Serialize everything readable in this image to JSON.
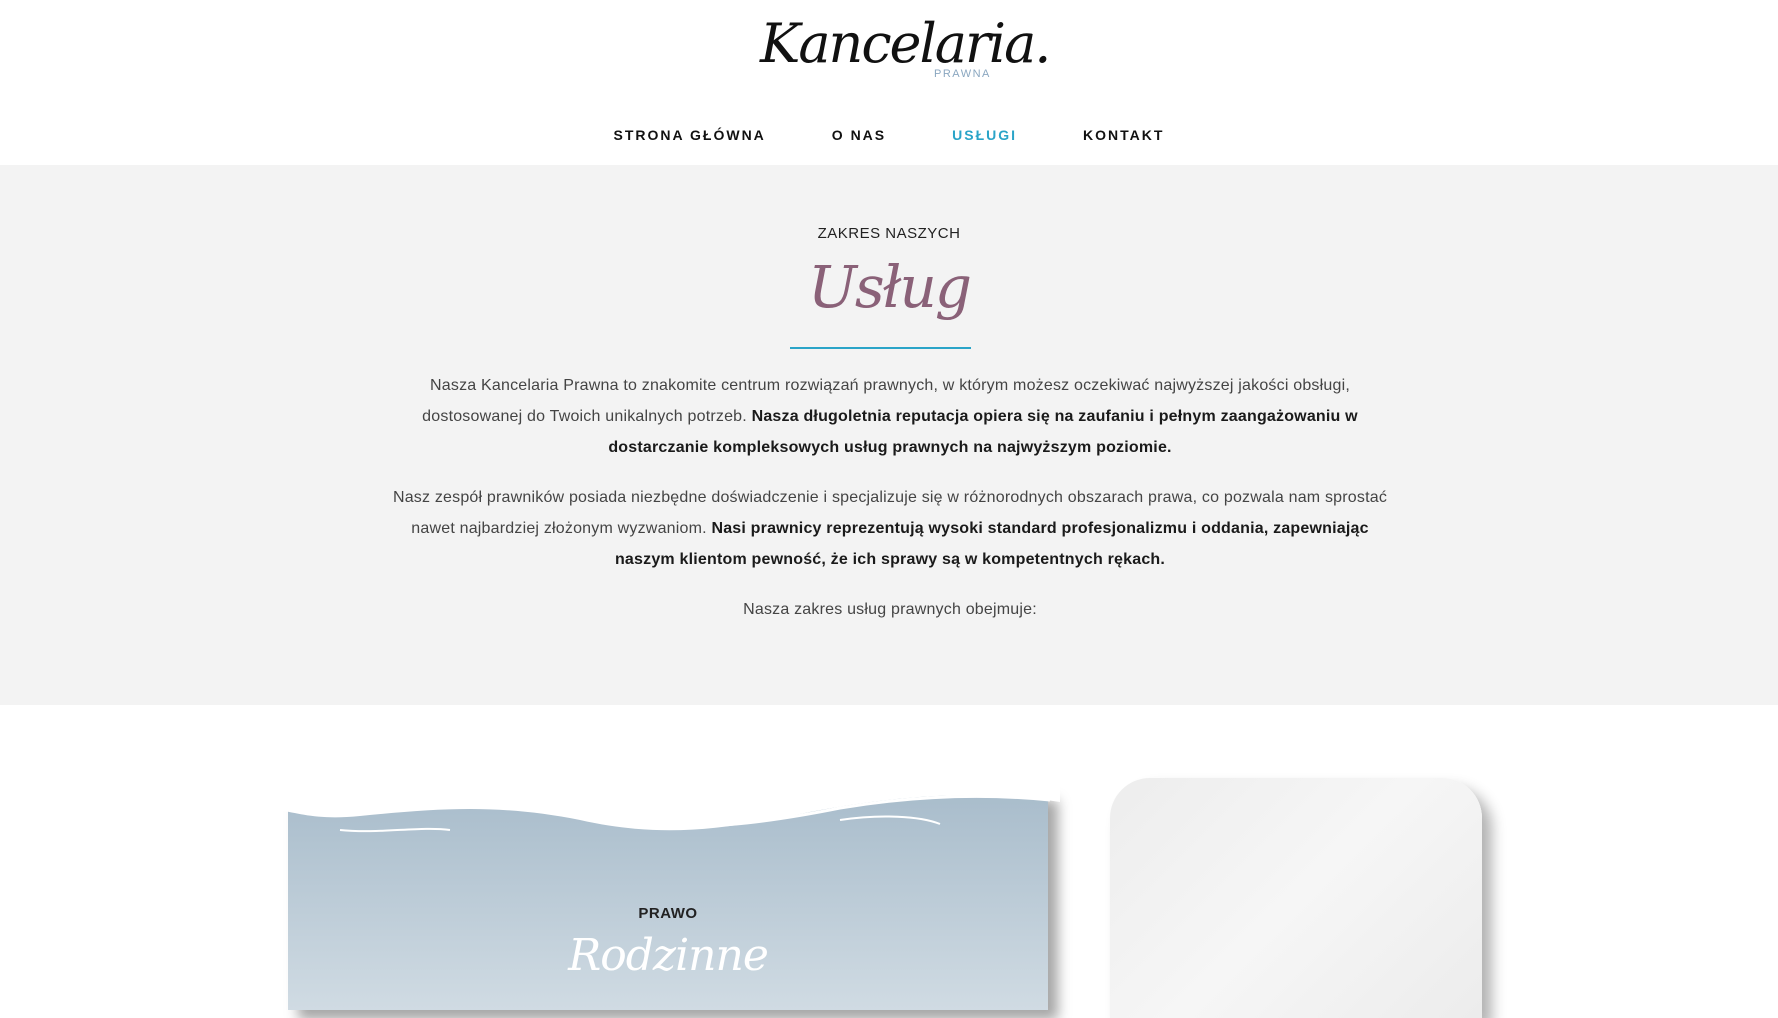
{
  "brand": {
    "logo_script": "Kancelaria.",
    "logo_sub": "PRAWNA"
  },
  "nav": {
    "items": [
      {
        "label": "STRONA GŁÓWNA",
        "active": false
      },
      {
        "label": "O NAS",
        "active": false
      },
      {
        "label": "USŁUGI",
        "active": true
      },
      {
        "label": "KONTAKT",
        "active": false
      }
    ]
  },
  "intro": {
    "eyebrow": "ZAKRES NASZYCH",
    "script_title": "Usług",
    "p1_normal": "Nasza Kancelaria Prawna to znakomite centrum rozwiązań prawnych, w którym możesz oczekiwać najwyższej jakości obsługi, dostosowanej do Twoich unikalnych potrzeb. ",
    "p1_bold": "Nasza długoletnia reputacja opiera się na zaufaniu i pełnym zaangażowaniu w dostarczanie kompleksowych usług prawnych na najwyższym poziomie.",
    "p2_normal": "Nasz zespół prawników posiada niezbędne doświadczenie i specjalizuje się w różnorodnych obszarach prawa, co pozwala nam sprostać nawet najbardziej złożonym wyzwaniom. ",
    "p2_bold": "Nasi prawnicy reprezentują wysoki standard profesjonalizmu i oddania, zapewniając naszym klientom pewność, że ich sprawy są w kompetentnych rękach.",
    "p3": "Nasza zakres usług prawnych obejmuje:"
  },
  "cards": {
    "card1": {
      "eyebrow": "PRAWO",
      "script": "Rodzinne"
    }
  },
  "colors": {
    "accent": "#2aa4c8",
    "script_title": "#8a6178",
    "intro_bg": "#f3f3f3",
    "card_blue": "#a8bccb"
  }
}
